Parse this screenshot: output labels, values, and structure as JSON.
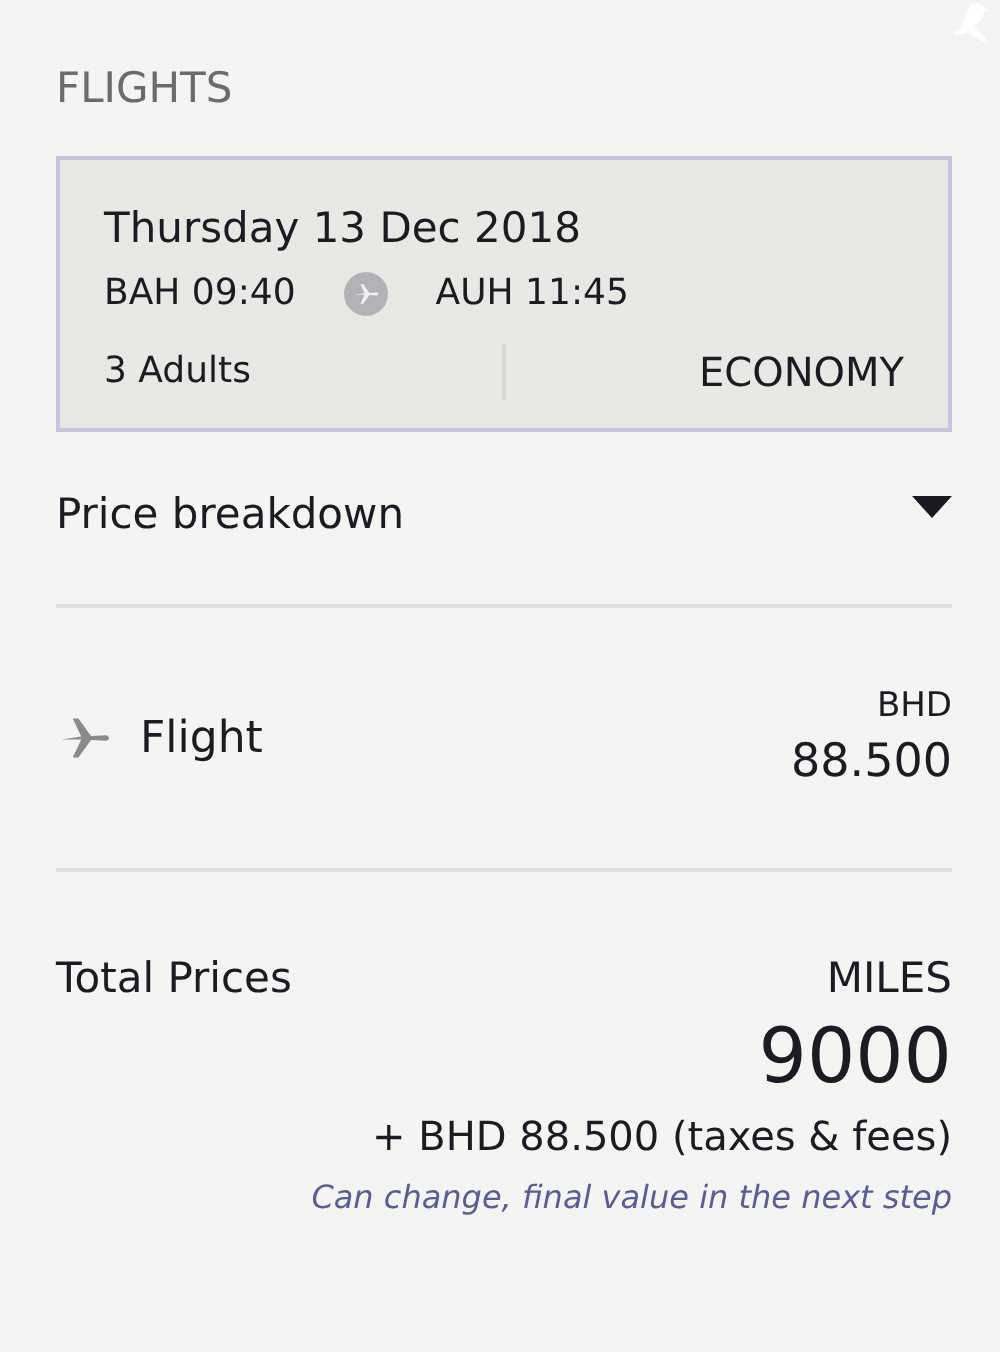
{
  "section_title": "FLIGHTS",
  "flight_card": {
    "date": "Thursday 13 Dec 2018",
    "departure": "BAH 09:40",
    "arrival": "AUH 11:45",
    "passengers": "3 Adults",
    "cabin": "ECONOMY"
  },
  "price_breakdown": {
    "title": "Price breakdown",
    "items": [
      {
        "label": "Flight",
        "currency": "BHD",
        "amount": "88.500"
      }
    ]
  },
  "total": {
    "label": "Total Prices",
    "unit": "MILES",
    "amount": "9000",
    "extra": "+ BHD 88.500 (taxes & fees)",
    "note": "Can change, final value in the next step"
  }
}
